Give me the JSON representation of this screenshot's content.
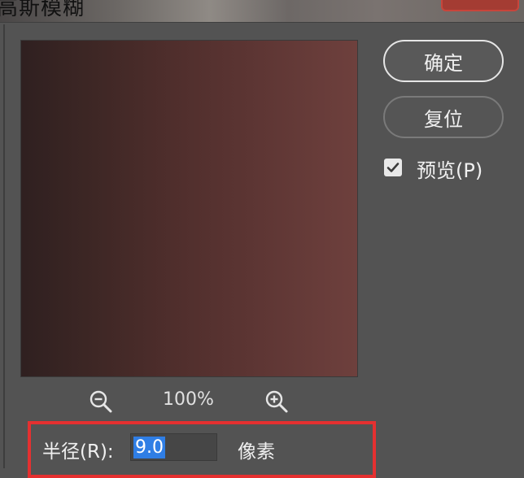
{
  "window": {
    "title": "高斯模糊"
  },
  "buttons": {
    "ok_label": "确定",
    "reset_label": "复位"
  },
  "preview_option": {
    "label": "预览(P)",
    "checked": true
  },
  "zoom": {
    "level": "100%",
    "zoom_out_icon": "zoom-out-icon",
    "zoom_in_icon": "zoom-in-icon"
  },
  "radius": {
    "label": "半径(R):",
    "value": "9.0",
    "unit": "像素"
  },
  "colors": {
    "dialog_bg": "#535353",
    "selection": "#2f7ee5",
    "highlight_border": "#e53030"
  }
}
